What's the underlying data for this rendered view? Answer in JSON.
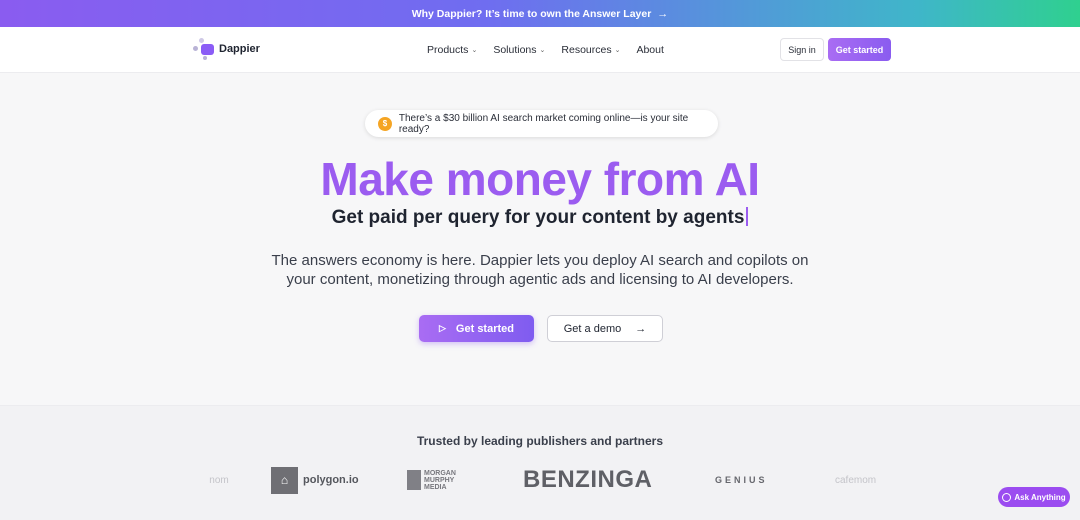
{
  "announcement": {
    "text": "Why Dappier? It’s time to own the Answer Layer",
    "arrow": "→"
  },
  "nav": {
    "logo_text": "Dappier",
    "menu": [
      {
        "label": "Products",
        "has_dropdown": true
      },
      {
        "label": "Solutions",
        "has_dropdown": true
      },
      {
        "label": "Resources",
        "has_dropdown": true
      },
      {
        "label": "About",
        "has_dropdown": false
      }
    ],
    "chevron": "⌄",
    "sign_in": "Sign in",
    "get_started": "Get started"
  },
  "hero": {
    "pill_icon": "$",
    "pill_text": "There’s a $30 billion AI search market coming online—is your site ready?",
    "title": "Make money from AI",
    "subtitle": "Get paid per query for your content by agents",
    "description": "The answers economy is here. Dappier lets you deploy AI search and copilots on your content, monetizing through agentic ads and licensing to AI developers.",
    "cta_primary": "Get started",
    "cta_primary_icon": "▷",
    "cta_secondary": "Get a demo",
    "cta_secondary_icon": "→"
  },
  "trusted": {
    "title": "Trusted by leading publishers and partners",
    "logos": {
      "nom": "nom",
      "polygon": "polygon.io",
      "polygon_icon": "⌂",
      "morgan_line1": "MORGAN",
      "morgan_line2": "MURPHY",
      "morgan_line3": "MEDIA",
      "benzinga": "BENZINGA",
      "genius": "GENIUS",
      "cafemom": "cafemom"
    }
  },
  "ask_widget": {
    "label": "Ask Anything"
  },
  "colors": {
    "brand_purple": "#9b5cf0",
    "button_gradient_start": "#a96cf3",
    "button_gradient_end": "#8a5cf0"
  }
}
